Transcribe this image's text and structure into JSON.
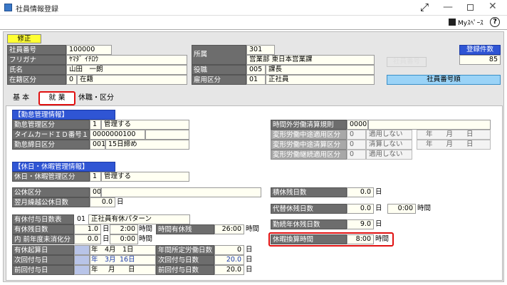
{
  "window": {
    "title": "社員情報登録",
    "maximize_icon": "expand-arrows-icon",
    "myspace": "Myｽﾍﾟｰｽ"
  },
  "header": {
    "mode": "修正",
    "fields": [
      {
        "label": "社員番号",
        "value": "100000"
      },
      {
        "label": "フリガナ",
        "value": "ﾔﾏﾀﾞ ｲﾁﾛｳ"
      },
      {
        "label": "氏名",
        "value": "山田　一朗"
      },
      {
        "label": "在籍区分",
        "code": "0",
        "value": "在籍"
      }
    ],
    "affiliation": {
      "label": "所属",
      "code": "301",
      "value": "営業部 東日本営業課"
    },
    "position": {
      "label": "役職",
      "code": "005",
      "value": "課長"
    },
    "employment": {
      "label": "雇用区分",
      "code": "01",
      "value": "正社員"
    },
    "faded_button": "社員番号",
    "count_label": "登録件数",
    "count_value": "85",
    "sort_button": "社員番号順"
  },
  "tabs": [
    "基 本",
    "就 業",
    "休職・区分"
  ],
  "work": {
    "attendance_header": "【勤怠管理情報】",
    "attendance": [
      {
        "label": "勤怠管理区分",
        "code": "1",
        "value": "管理する"
      },
      {
        "label": "タイムカードＩＤ番号１",
        "value": "0000000100"
      },
      {
        "label": "勤怠締日区分",
        "code": "001",
        "value": "15日締め"
      }
    ],
    "overtime": {
      "label": "時間外労働清算規則",
      "code": "0000"
    },
    "variable": [
      {
        "label": "変形労働中途適用区分",
        "code": "0",
        "value": "適用しない",
        "ym": "年　　月　　日"
      },
      {
        "label": "変形労働中途清算区分",
        "code": "0",
        "value": "清算しない",
        "ym": "年　　月　　日"
      },
      {
        "label": "変形労働継続適用区分",
        "code": "0",
        "value": "適用しない"
      }
    ],
    "leave_header": "【休日・休暇管理情報】",
    "leave_mgmt": {
      "label": "休日・休暇管理区分",
      "code": "1",
      "value": "管理する"
    },
    "public": {
      "label": "公休区分",
      "code": "00"
    },
    "carry": {
      "label": "翌月繰越公休日数",
      "value": "0.0",
      "unit": "日"
    },
    "accum": {
      "label": "積休残日数",
      "value": "0.0",
      "unit": "日"
    },
    "subst": {
      "label": "代替休残日数",
      "value": "0.0",
      "unit": "日",
      "time": "0:00",
      "time_unit": "時間"
    },
    "service": {
      "label": "勤続年休残日数",
      "value": "9.0",
      "unit": "日"
    },
    "conv": {
      "label": "休暇換算時間",
      "value": "8:00",
      "unit": "時間"
    },
    "paid_table": {
      "label": "有休付与日数表",
      "code": "01",
      "value": "正社員有休パターン"
    },
    "paid_remain": {
      "label": "有休残日数",
      "value": "1.0",
      "unit": "日",
      "time": "2:00",
      "time_unit": "時間"
    },
    "paid_remain_time": {
      "label": "時間有休残",
      "value": "26:00",
      "unit": "時間"
    },
    "prev_unused": {
      "label": "内 前年度未消化分",
      "value": "0.0",
      "unit": "日",
      "time": "0:00",
      "time_unit": "時間"
    },
    "paid_start": {
      "label": "有休起算日",
      "y": "年",
      "m": "4月",
      "d": "1日"
    },
    "annual_days": {
      "label": "年間所定労働日数",
      "value": "0",
      "unit": "日"
    },
    "next_grant": {
      "label": "次回付与日",
      "y": "年",
      "m": "3月",
      "d": "16日"
    },
    "next_grant_days": {
      "label": "次回付与日数",
      "value": "20.0",
      "unit": "日"
    },
    "prev_grant": {
      "label": "前回付与日",
      "y": "年",
      "m": "月",
      "d": "日"
    },
    "prev_grant_days": {
      "label": "前回付与日数",
      "value": "20.0",
      "unit": "日"
    }
  }
}
